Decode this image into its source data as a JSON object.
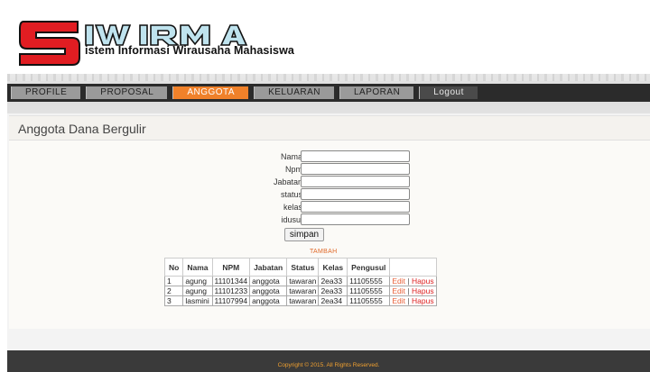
{
  "brand": {
    "logo_text": "SIWIRMA",
    "tagline": "istem Informasi Wirausaha Mahasiswa",
    "colors": {
      "logo_red": "#e11d22",
      "logo_blue": "#bfe3ee"
    }
  },
  "nav": {
    "items": [
      {
        "label": "PROFILE"
      },
      {
        "label": "PROPOSAL"
      },
      {
        "label": "ANGGOTA"
      },
      {
        "label": "KELUARAN"
      },
      {
        "label": "LAPORAN"
      },
      {
        "label": "Logout"
      }
    ],
    "active": "ANGGOTA",
    "accent": "#f0812a"
  },
  "page": {
    "title": "Anggota Dana Bergulir"
  },
  "form": {
    "fields": [
      {
        "label": "Nama",
        "value": ""
      },
      {
        "label": "Npm",
        "value": ""
      },
      {
        "label": "Jabatan",
        "value": ""
      },
      {
        "label": "status",
        "value": ""
      },
      {
        "label": "kelas",
        "value": ""
      },
      {
        "label": "idusul",
        "value": ""
      }
    ],
    "submit_label": "simpan",
    "tambah_label": "TAMBAH"
  },
  "table": {
    "headers": [
      "No",
      "Nama",
      "NPM",
      "Jabatan",
      "Status",
      "Kelas",
      "Pengusul",
      ""
    ],
    "rows": [
      {
        "no": "1",
        "nama": "agung",
        "npm": "11101344",
        "jabatan": "anggota",
        "status": "tawaran",
        "kelas": "2ea33",
        "pengusul": "11105555"
      },
      {
        "no": "2",
        "nama": "agung",
        "npm": "11101233",
        "jabatan": "anggota",
        "status": "tawaran",
        "kelas": "2ea33",
        "pengusul": "11105555"
      },
      {
        "no": "3",
        "nama": "lasmini",
        "npm": "11107994",
        "jabatan": "anggota",
        "status": "tawaran",
        "kelas": "2ea34",
        "pengusul": "11105555"
      }
    ],
    "edit_label": "Edit",
    "separator": "|",
    "delete_label": "Hapus"
  },
  "footer": {
    "copyright": "Copyright © 2015. All Rights Reserved."
  }
}
